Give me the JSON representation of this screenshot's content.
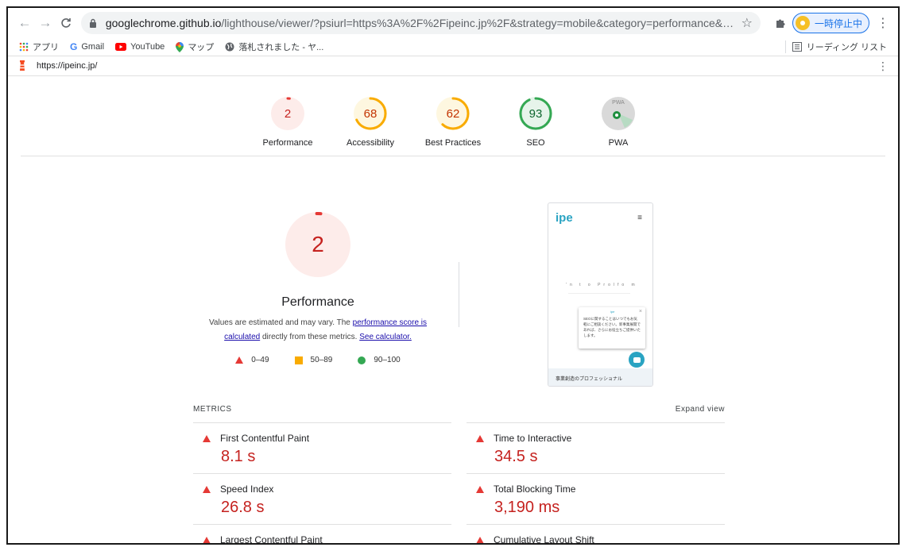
{
  "browser": {
    "url_host": "googlechrome.github.io",
    "url_rest": "/lighthouse/viewer/?psiurl=https%3A%2F%2Fipeinc.jp%2F&strategy=mobile&category=performance&category=...",
    "profile_label": "一時停止中"
  },
  "bookmarks": {
    "items": [
      {
        "label": "アプリ",
        "icon": "apps-grid-icon"
      },
      {
        "label": "Gmail",
        "icon": "google-g-icon"
      },
      {
        "label": "YouTube",
        "icon": "youtube-icon"
      },
      {
        "label": "マップ",
        "icon": "maps-pin-icon"
      },
      {
        "label": "落札されました - ヤ...",
        "icon": "globe-icon"
      }
    ],
    "reading_list": "リーディング リスト"
  },
  "lighthouse": {
    "page_url": "https://ipeinc.jp/"
  },
  "gauges": [
    {
      "label": "Performance",
      "score": 2,
      "color": "#e53935",
      "bg": "#fdecea"
    },
    {
      "label": "Accessibility",
      "score": 68,
      "color": "#f9ab00",
      "bg": "#fef7e0"
    },
    {
      "label": "Best Practices",
      "score": 62,
      "color": "#f9ab00",
      "bg": "#fef7e0"
    },
    {
      "label": "SEO",
      "score": 93,
      "color": "#34a853",
      "bg": "#e6f4ea"
    },
    {
      "label": "PWA",
      "score": "PWA"
    }
  ],
  "summary": {
    "score": "2",
    "title": "Performance",
    "desc_prefix": "Values are estimated and may vary. The ",
    "desc_link1": "performance score is calculated",
    "desc_middle": " directly from these metrics. ",
    "desc_link2": "See calculator.",
    "legend": [
      "0–49",
      "50–89",
      "90–100"
    ]
  },
  "screenshot": {
    "logo": "ipe",
    "mid_text": "'n  t o  Prolfo m",
    "popup_brand": "ipe",
    "popup_text": "SEOに関することはいつでもお気軽にご相談ください。新事業展開であれば、さらにお役立ちご提供いたします。",
    "footer": "事業創造のプロフェッショナル"
  },
  "metrics": {
    "heading": "METRICS",
    "expand": "Expand view",
    "left": [
      {
        "label": "First Contentful Paint",
        "value": "8.1 s"
      },
      {
        "label": "Speed Index",
        "value": "26.8 s"
      },
      {
        "label": "Largest Contentful Paint",
        "value": ""
      }
    ],
    "right": [
      {
        "label": "Time to Interactive",
        "value": "34.5 s"
      },
      {
        "label": "Total Blocking Time",
        "value": "3,190 ms"
      },
      {
        "label": "Cumulative Layout Shift",
        "value": ""
      }
    ]
  }
}
